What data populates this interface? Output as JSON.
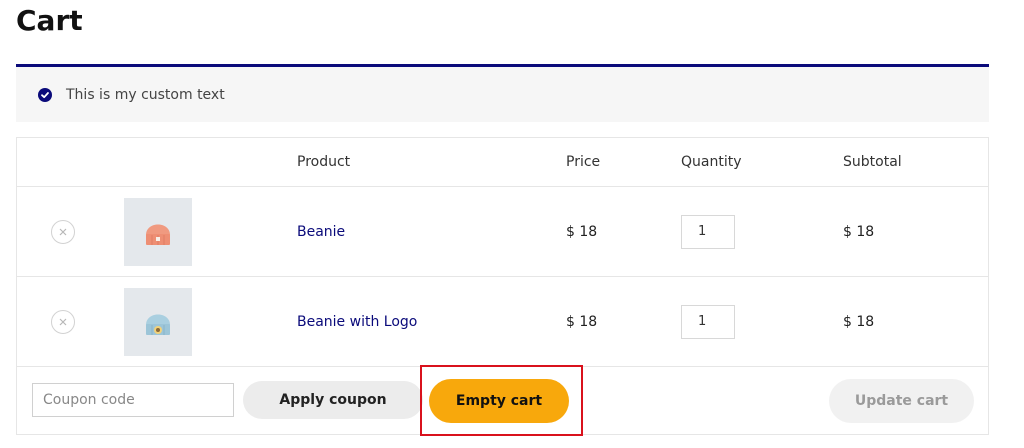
{
  "page": {
    "title": "Cart"
  },
  "notice": {
    "text": "This is my custom text",
    "icon": "check-circle-icon",
    "accent": "#0a0a7a"
  },
  "table": {
    "headers": {
      "product": "Product",
      "price": "Price",
      "quantity": "Quantity",
      "subtotal": "Subtotal"
    },
    "items": [
      {
        "name": "Beanie",
        "price": "$ 18",
        "quantity": "1",
        "subtotal": "$ 18",
        "thumb_color": "#f09a80"
      },
      {
        "name": "Beanie with Logo",
        "price": "$ 18",
        "quantity": "1",
        "subtotal": "$ 18",
        "thumb_color": "#a9cfe0"
      }
    ]
  },
  "actions": {
    "coupon_placeholder": "Coupon code",
    "apply_label": "Apply coupon",
    "empty_label": "Empty cart",
    "update_label": "Update cart",
    "empty_color": "#f8a80c",
    "highlight_color": "#d9111c"
  }
}
